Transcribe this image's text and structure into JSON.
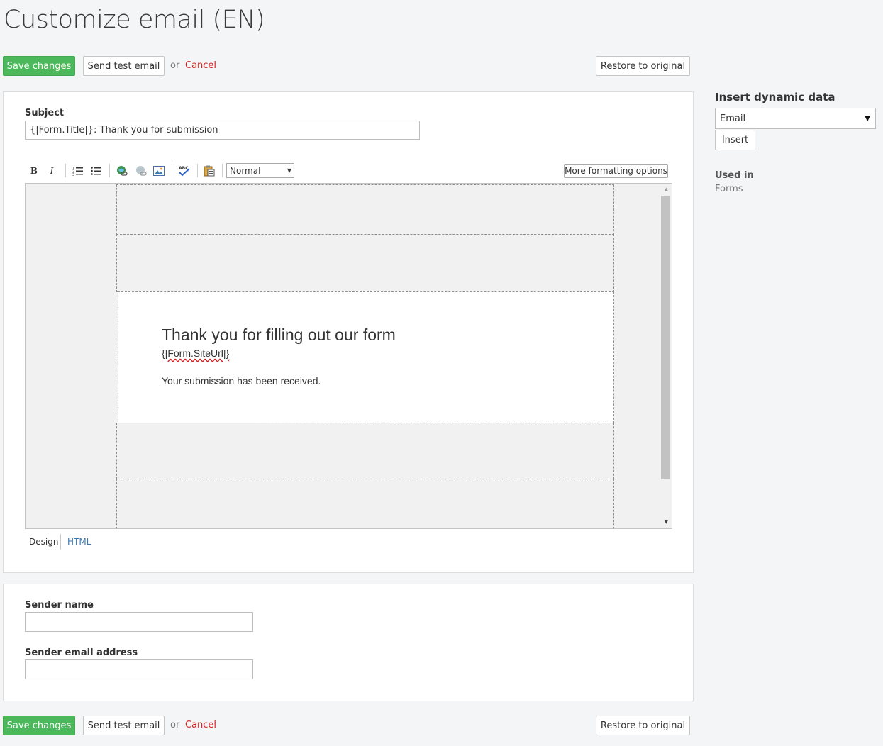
{
  "page": {
    "title": "Customize email (EN)"
  },
  "actions": {
    "save_label": "Save changes",
    "send_test_label": "Send test email",
    "or_text": "or",
    "cancel_label": "Cancel",
    "restore_label": "Restore to original"
  },
  "subject": {
    "label": "Subject",
    "value": "{|Form.Title|}: Thank you for submission"
  },
  "toolbar": {
    "bold": "B",
    "italic": "I",
    "format_value": "Normal",
    "more_formatting_label": "More formatting options"
  },
  "email_body": {
    "heading": "Thank you for filling out our form",
    "site_url": "{|Form.SiteUrl|}",
    "message": "Your submission has been received."
  },
  "view_tabs": {
    "design": "Design",
    "html": "HTML"
  },
  "sender": {
    "name_label": "Sender name",
    "name_value": "",
    "email_label": "Sender email address",
    "email_value": ""
  },
  "sidebar": {
    "insert_title": "Insert dynamic data",
    "select_value": "Email",
    "insert_button": "Insert",
    "used_in_label": "Used in",
    "used_in_value": "Forms"
  },
  "colors": {
    "primary_green": "#4cb85c",
    "cancel_red": "#d42323",
    "link_blue": "#3a78b8"
  }
}
